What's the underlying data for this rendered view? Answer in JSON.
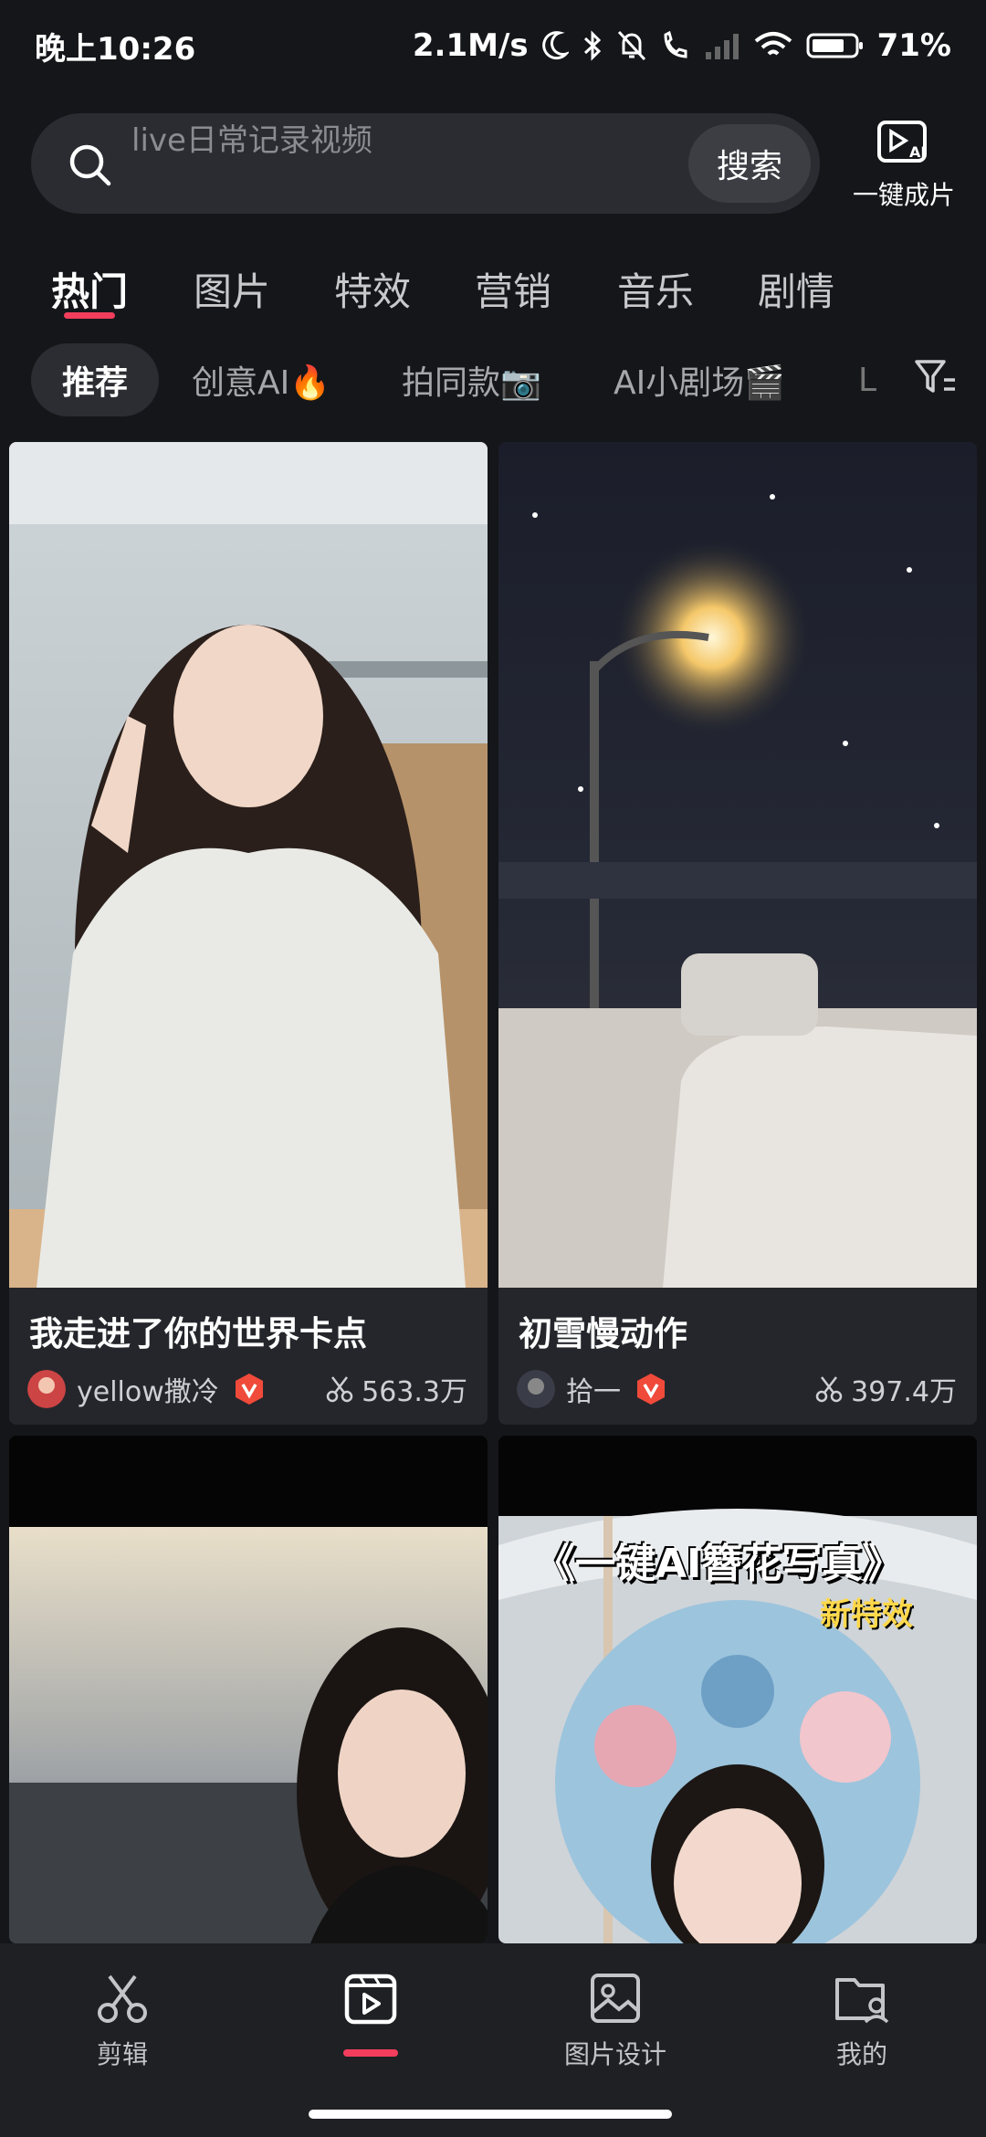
{
  "status_bar": {
    "time": "晚上10:26",
    "network_speed": "2.1M/s",
    "battery": "71%"
  },
  "search": {
    "placeholder": "live日常记录视频",
    "button_label": "搜索",
    "ai_film_label": "一键成片"
  },
  "main_tabs": [
    "热门",
    "图片",
    "特效",
    "营销",
    "音乐",
    "剧情"
  ],
  "active_main_tab": "热门",
  "chips": [
    "推荐",
    "创意AI🔥",
    "拍同款📷",
    "AI小剧场🎬",
    "L"
  ],
  "cards": [
    {
      "title": "我走进了你的世界卡点",
      "author": "yellow撒冷",
      "usage": "563.3万"
    },
    {
      "title": "初雪慢动作",
      "author": "拾一",
      "usage": "397.4万"
    },
    {
      "title": "",
      "author": "",
      "usage": ""
    },
    {
      "title": "",
      "overlay_title": "《一键AI簪花写真》",
      "overlay_badge": "新特效"
    }
  ],
  "bottom_nav": [
    {
      "label": "剪辑",
      "icon": "scissors-icon"
    },
    {
      "label": "",
      "icon": "template-icon"
    },
    {
      "label": "图片设计",
      "icon": "image-icon"
    },
    {
      "label": "我的",
      "icon": "profile-folder-icon"
    }
  ],
  "colors": {
    "accent": "#f23e5c",
    "background": "#15161a",
    "card": "#25262b",
    "vbadge": "#f04a3a"
  }
}
